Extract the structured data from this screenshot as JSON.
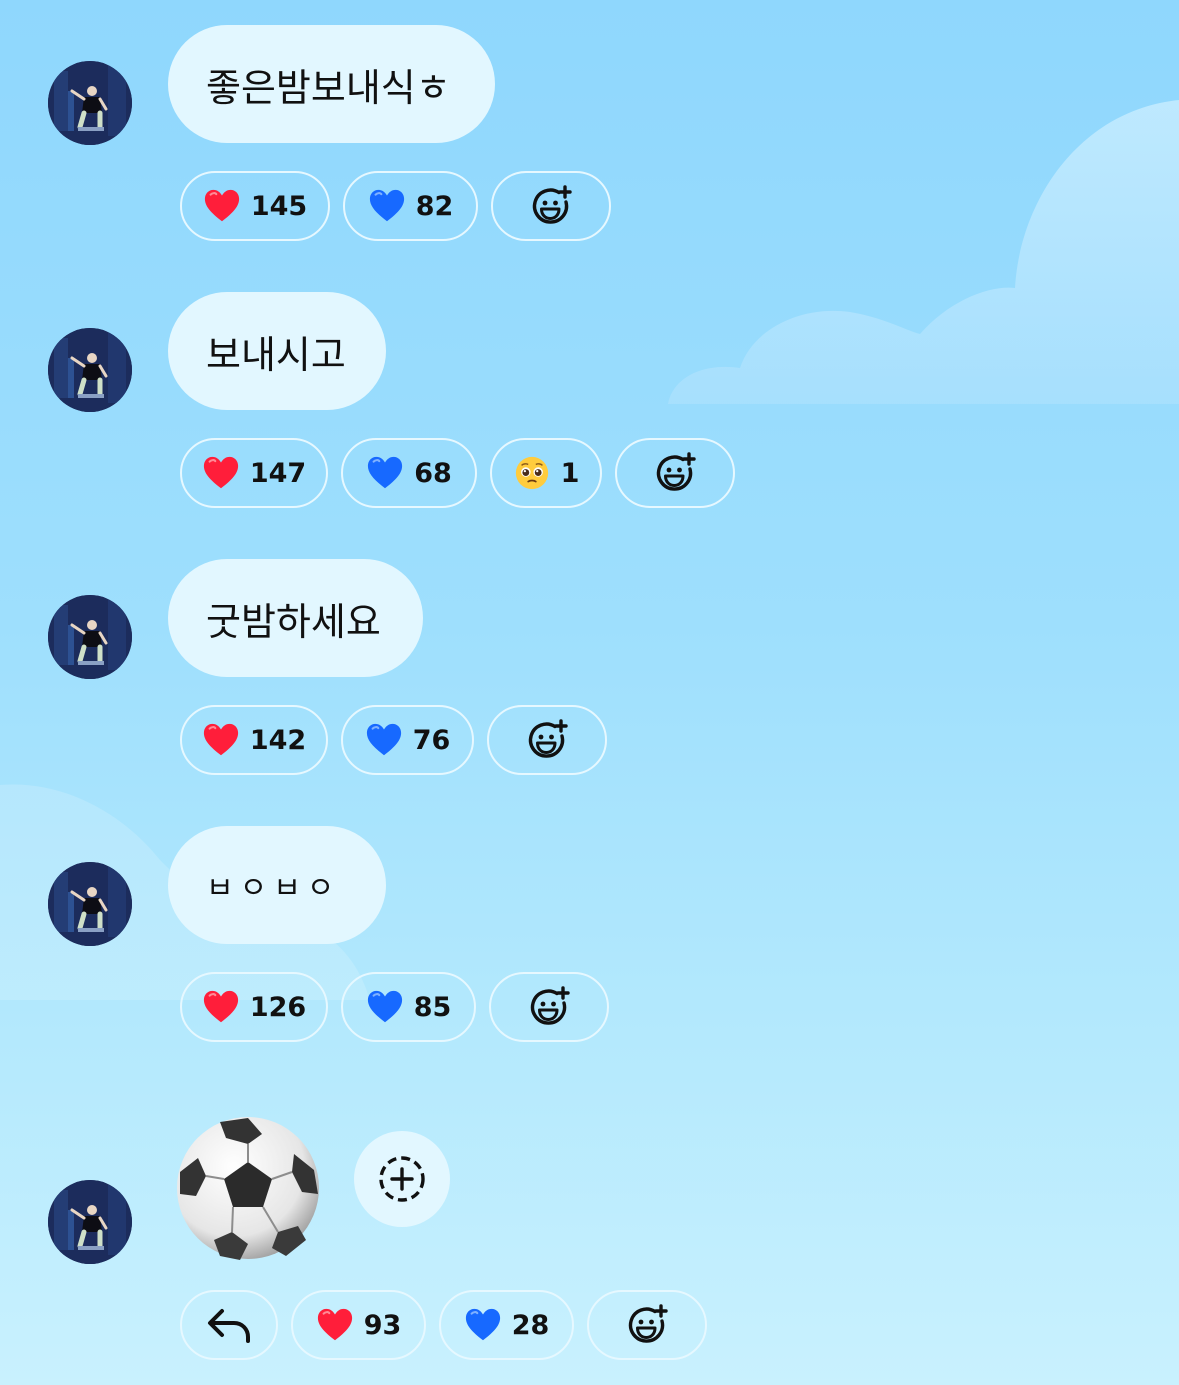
{
  "messages": [
    {
      "text": "좋은밤보내식ㅎ",
      "reactions": [
        {
          "emoji": "red-heart",
          "count": "145"
        },
        {
          "emoji": "blue-heart",
          "count": "82"
        }
      ]
    },
    {
      "text": "보내시고",
      "reactions": [
        {
          "emoji": "red-heart",
          "count": "147"
        },
        {
          "emoji": "blue-heart",
          "count": "68"
        },
        {
          "emoji": "pleading-face",
          "count": "1"
        }
      ]
    },
    {
      "text": "굿밤하세요",
      "reactions": [
        {
          "emoji": "red-heart",
          "count": "142"
        },
        {
          "emoji": "blue-heart",
          "count": "76"
        }
      ]
    },
    {
      "text": "ㅂㅇㅂㅇ",
      "reactions": [
        {
          "emoji": "red-heart",
          "count": "126"
        },
        {
          "emoji": "blue-heart",
          "count": "85"
        }
      ]
    },
    {
      "sticker": "soccer-ball",
      "reactions": [
        {
          "emoji": "red-heart",
          "count": "93"
        },
        {
          "emoji": "blue-heart",
          "count": "28"
        }
      ]
    }
  ],
  "icons": {
    "add_reaction": "add-reaction-icon",
    "reply": "reply-arrow-icon",
    "add_sticker": "add-sticker-icon"
  },
  "colors": {
    "bubble": "#e2f7ff",
    "pill_border": "#e6f8ff",
    "red_heart": "#ff1e3a",
    "blue_heart": "#1769ff"
  }
}
